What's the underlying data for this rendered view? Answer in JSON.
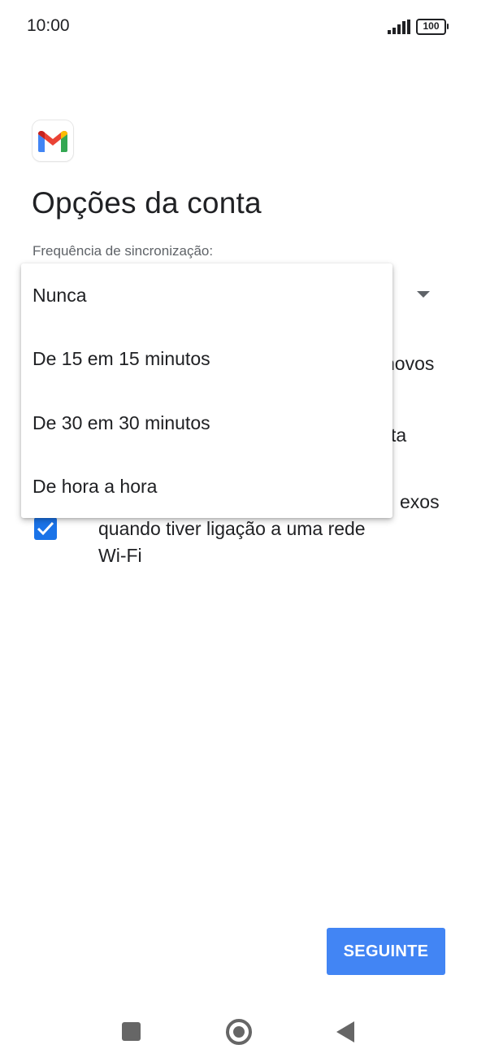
{
  "status_bar": {
    "time": "10:00",
    "battery": "100",
    "icons": [
      "signal-icon",
      "battery-icon"
    ]
  },
  "app": {
    "logo_icon": "gmail-logo-icon"
  },
  "page": {
    "title": "Opções da conta",
    "sync_label": "Frequência de sincronização:"
  },
  "options": {
    "row1_line": "novos",
    "row2_line": "ta",
    "row3_line1": "exos",
    "row3_line2": "quando tiver ligação a uma rede",
    "row3_line3": "Wi-Fi",
    "row3_checked": true
  },
  "dropdown_menu": {
    "items": [
      {
        "label": "Nunca"
      },
      {
        "label": "De 15 em 15 minutos"
      },
      {
        "label": "De 30 em 30 minutos"
      },
      {
        "label": "De hora a hora"
      }
    ]
  },
  "actions": {
    "next_label": "SEGUINTE"
  },
  "colors": {
    "primary": "#1a73e8",
    "button": "#4285f4",
    "text": "#202124",
    "secondary_text": "#5f6368",
    "gmail_red": "#ea4335",
    "gmail_blue": "#4285f4",
    "gmail_green": "#34a853",
    "gmail_yellow": "#fbbc04"
  },
  "nav_bar": {
    "icons": [
      "recents-icon",
      "home-icon",
      "back-icon"
    ]
  }
}
